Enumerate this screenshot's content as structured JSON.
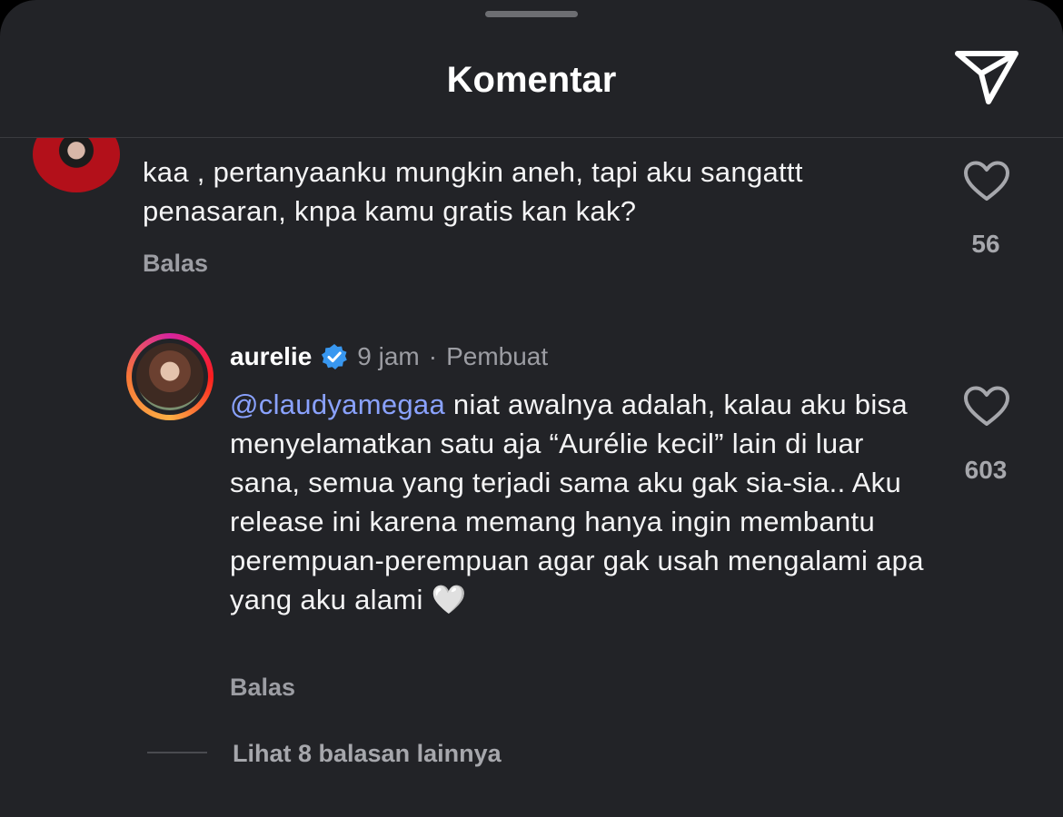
{
  "header": {
    "title": "Komentar"
  },
  "comments": [
    {
      "text": "kaa , pertanyaanku mungkin aneh, tapi aku sangattt penasaran, knpa kamu gratis kan kak?",
      "reply_label": "Balas",
      "likes": "56"
    },
    {
      "username": "aurelie",
      "verified": true,
      "time": "9 jam",
      "separator": "·",
      "role": "Pembuat",
      "mention": "@claudyamegaa",
      "text": " niat awalnya adalah, kalau aku bisa menyelamatkan satu aja “Aurélie kecil” lain di luar sana, semua yang terjadi sama aku gak sia-sia.. Aku release ini karena memang hanya ingin membantu perempuan-perempuan agar gak usah mengalami apa yang aku alami ",
      "emoji": "🤍",
      "reply_label": "Balas",
      "likes": "603",
      "more_replies": "Lihat 8 balasan lainnya"
    }
  ],
  "colors": {
    "background": "#222327",
    "text": "#f4f4f5",
    "secondary_text": "#9c9da3",
    "mention": "#8aa2ff",
    "verified_badge": "#3897f0"
  },
  "icons": [
    "send-icon",
    "heart-icon",
    "verified-badge-icon"
  ]
}
